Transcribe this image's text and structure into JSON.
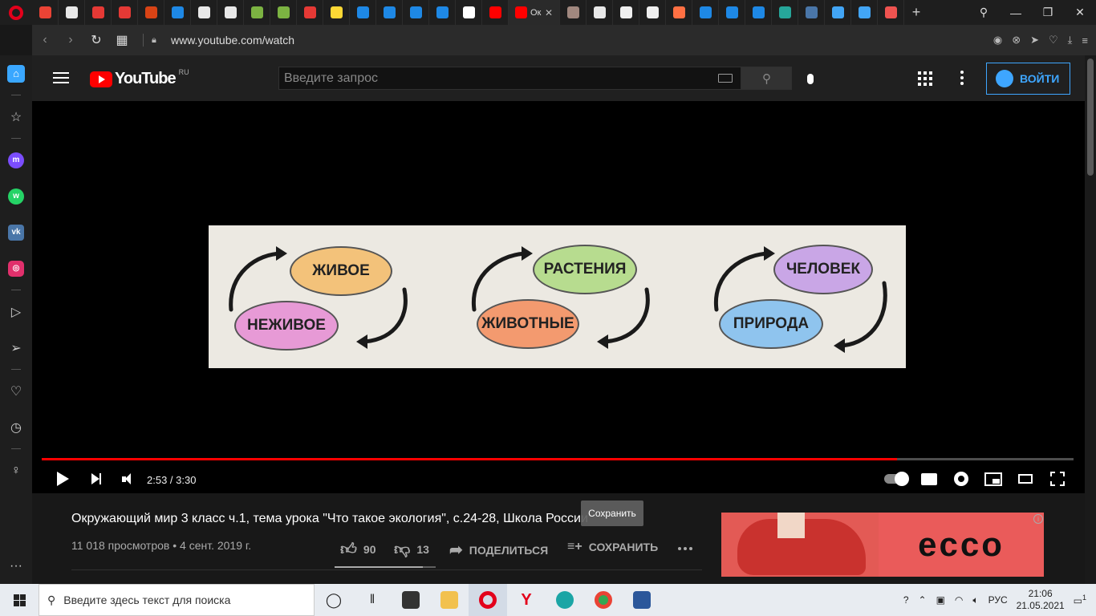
{
  "browser": {
    "tabs": [
      {
        "icon": "gmail-icon",
        "color": "#ea4335"
      },
      {
        "icon": "doc-icon",
        "color": "#e8e8e8"
      },
      {
        "icon": "pdf-icon",
        "color": "#e53935"
      },
      {
        "icon": "pdf-icon",
        "color": "#e53935"
      },
      {
        "icon": "eduneo-icon",
        "color": "#d84315"
      },
      {
        "icon": "screen-icon",
        "color": "#1e88e5"
      },
      {
        "icon": "doc-icon",
        "color": "#e8e8e8"
      },
      {
        "icon": "doc-icon",
        "color": "#e8e8e8"
      },
      {
        "icon": "globe-icon",
        "color": "#7cb342"
      },
      {
        "icon": "globe-icon",
        "color": "#7cb342"
      },
      {
        "icon": "pdf-icon",
        "color": "#e53935"
      },
      {
        "icon": "info-icon",
        "color": "#fdd835"
      },
      {
        "icon": "mail-icon",
        "color": "#1e88e5"
      },
      {
        "icon": "mail-icon",
        "color": "#1e88e5"
      },
      {
        "icon": "mail-icon",
        "color": "#1e88e5"
      },
      {
        "icon": "mail-icon",
        "color": "#1e88e5"
      },
      {
        "icon": "google-icon",
        "color": "#ffffff"
      },
      {
        "icon": "youtube-icon",
        "color": "#ff0000"
      }
    ],
    "active_tab_title": "Ок",
    "tabs_after": [
      {
        "icon": "cat-icon",
        "color": "#a1887f"
      },
      {
        "icon": "doc-icon",
        "color": "#e8e8e8"
      },
      {
        "icon": "brush-icon",
        "color": "#eeeeee"
      },
      {
        "icon": "brush-icon",
        "color": "#eeeeee"
      },
      {
        "icon": "image-icon",
        "color": "#ff7043"
      },
      {
        "icon": "script-icon",
        "color": "#1e88e5"
      },
      {
        "icon": "app-icon",
        "color": "#1e88e5"
      },
      {
        "icon": "chat-icon",
        "color": "#1e88e5"
      },
      {
        "icon": "book-icon",
        "color": "#26a69a"
      },
      {
        "icon": "vk-icon",
        "color": "#4a76a8"
      },
      {
        "icon": "photo-icon",
        "color": "#42a5f5"
      },
      {
        "icon": "alpha-icon",
        "color": "#42a5f5"
      },
      {
        "icon": "shield-icon",
        "color": "#ef5350"
      }
    ],
    "url": "www.youtube.com/watch"
  },
  "youtube": {
    "logo_text": "YouTube",
    "region": "RU",
    "search_placeholder": "Введите запрос",
    "signin_label": "ВОЙТИ"
  },
  "video": {
    "time": "2:53 / 3:30",
    "progress": 0.829,
    "frame": {
      "labels": [
        "ЖИВОЕ",
        "НЕЖИВОЕ",
        "РАСТЕНИЯ",
        "ЖИВОТНЫЕ",
        "ЧЕЛОВЕК",
        "ПРИРОДА"
      ],
      "colors": {
        "zhivoe": "#f3c27a",
        "nezhivoe": "#e79ad6",
        "rasteniya": "#b7dc8f",
        "zhivotnye": "#f39a6f",
        "chelovek": "#c9a6e6",
        "priroda": "#8fc4ee"
      }
    }
  },
  "details": {
    "title": "Окружающий мир 3 класс ч.1, тема урока \"Что такое экология\", с.24-28, Школа России",
    "views": "11 018 просмотров • 4 сент. 2019 г.",
    "likes": "90",
    "dislikes": "13",
    "share_label": "ПОДЕЛИТЬСЯ",
    "save_label": "СОХРАНИТЬ",
    "like_ratio": 0.874,
    "tooltip": "Сохранить"
  },
  "ad": {
    "brand": "ecco"
  },
  "taskbar": {
    "search_placeholder": "Введите здесь текст для поиска",
    "lang": "РУС",
    "time": "21:06",
    "date": "21.05.2021",
    "notification_count": "1"
  }
}
